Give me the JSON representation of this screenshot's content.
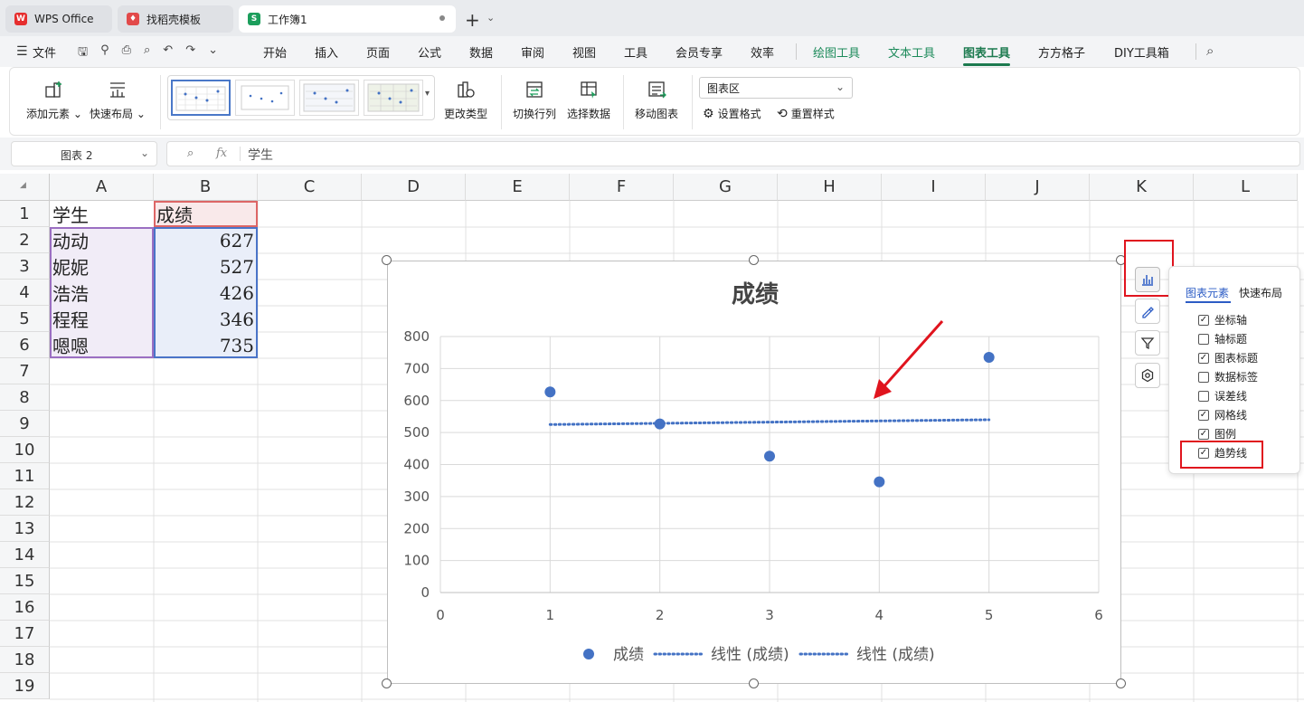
{
  "tabs": [
    {
      "label": "WPS Office",
      "icon": "wps-logo-icon"
    },
    {
      "label": "找稻壳模板",
      "icon": "docer-icon"
    },
    {
      "label": "工作簿1",
      "icon": "spreadsheet-icon"
    }
  ],
  "menu": {
    "file": "文件",
    "items": [
      "开始",
      "插入",
      "页面",
      "公式",
      "数据",
      "审阅",
      "视图",
      "工具",
      "会员专享",
      "效率",
      "绘图工具",
      "文本工具",
      "图表工具",
      "方方格子",
      "DIY工具箱"
    ],
    "active": "图表工具"
  },
  "ribbon": {
    "add_element": "添加元素",
    "quick_layout": "快速布局",
    "change_type": "更改类型",
    "switch_row_col": "切换行列",
    "select_data": "选择数据",
    "move_chart": "移动图表",
    "area_select": "图表区",
    "set_format": "设置格式",
    "reset_style": "重置样式"
  },
  "formula_bar": {
    "name_box": "图表 2",
    "fx": "fx",
    "content": "学生"
  },
  "columns": [
    "A",
    "B",
    "C",
    "D",
    "E",
    "F",
    "G",
    "H",
    "I",
    "J",
    "K",
    "L"
  ],
  "rows": [
    "1",
    "2",
    "3",
    "4",
    "5",
    "6",
    "7",
    "8",
    "9",
    "10",
    "11",
    "12",
    "13",
    "14",
    "15",
    "16",
    "17",
    "18",
    "19"
  ],
  "cells": {
    "A1": "学生",
    "B1": "成绩",
    "A2": "动动",
    "B2": "627",
    "A3": "妮妮",
    "B3": "527",
    "A4": "浩浩",
    "B4": "426",
    "A5": "程程",
    "B5": "346",
    "A6": "嗯嗯",
    "B6": "735"
  },
  "chart_data": {
    "type": "scatter",
    "title": "成绩",
    "x": [
      1,
      2,
      3,
      4,
      5
    ],
    "series": [
      {
        "name": "成绩",
        "values": [
          627,
          527,
          426,
          346,
          735
        ],
        "color": "#4472c4"
      }
    ],
    "trendlines": [
      {
        "name": "线性 (成绩)",
        "type": "linear",
        "x": [
          1,
          5
        ],
        "values": [
          525,
          540
        ]
      },
      {
        "name": "线性 (成绩)",
        "type": "linear",
        "x": [
          1,
          5
        ],
        "values": [
          525,
          540
        ]
      }
    ],
    "xlim": [
      0,
      6
    ],
    "ylim": [
      0,
      800
    ],
    "xticks": [
      "0",
      "1",
      "2",
      "3",
      "4",
      "5",
      "6"
    ],
    "yticks": [
      "0",
      "100",
      "200",
      "300",
      "400",
      "500",
      "600",
      "700",
      "800"
    ],
    "grid": true,
    "legend": "bottom",
    "legend_entries": [
      "成绩",
      "线性 (成绩)",
      "线性 (成绩)"
    ]
  },
  "chart_panel": {
    "tabs": [
      "图表元素",
      "快速布局"
    ],
    "items": [
      {
        "label": "坐标轴",
        "checked": true
      },
      {
        "label": "轴标题",
        "checked": false
      },
      {
        "label": "图表标题",
        "checked": true
      },
      {
        "label": "数据标签",
        "checked": false
      },
      {
        "label": "误差线",
        "checked": false
      },
      {
        "label": "网格线",
        "checked": true
      },
      {
        "label": "图例",
        "checked": true
      },
      {
        "label": "趋势线",
        "checked": true
      }
    ]
  },
  "colors": {
    "accent": "#1c7a4f",
    "highlight": "#e0141e",
    "series": "#4472c4"
  }
}
